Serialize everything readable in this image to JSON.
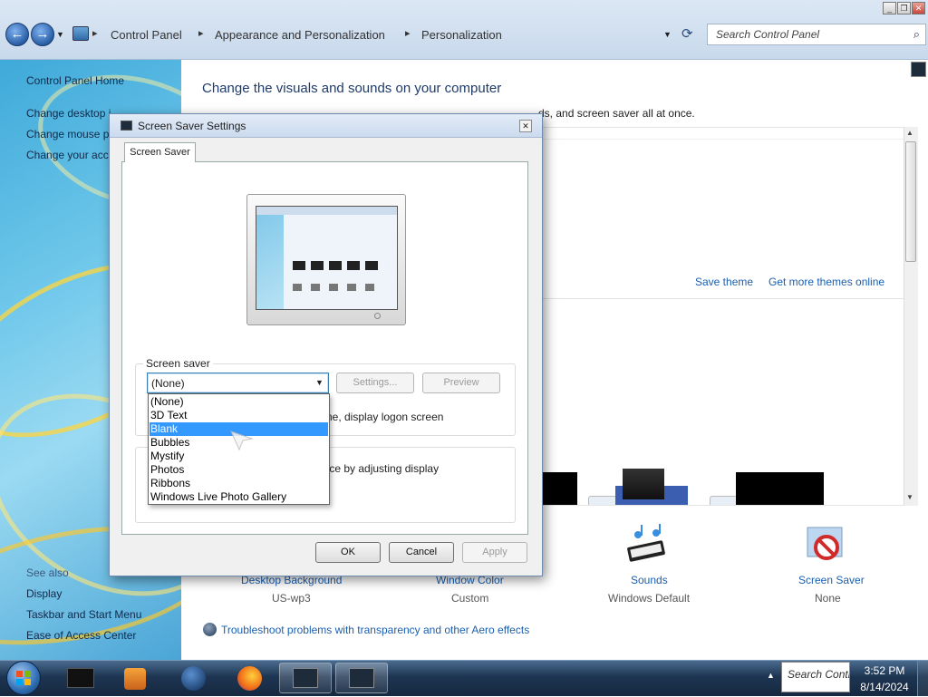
{
  "window": {
    "breadcrumb": [
      "Control Panel",
      "Appearance and Personalization",
      "Personalization"
    ],
    "search_placeholder": "Search Control Panel"
  },
  "left_pane": {
    "home": "Control Panel Home",
    "links": [
      "Change desktop i",
      "Change mouse p",
      "Change your acc"
    ],
    "see_also_heading": "See also",
    "see_also": [
      "Display",
      "Taskbar and Start Menu",
      "Ease of Access Center"
    ]
  },
  "main": {
    "heading": "Change the visuals and sounds on your computer",
    "description_tail": "ds, and screen saver all at once.",
    "save_theme": "Save theme",
    "get_more_themes": "Get more themes online",
    "settings": [
      {
        "label": "Desktop Background",
        "value": "US-wp3"
      },
      {
        "label": "Window Color",
        "value": "Custom"
      },
      {
        "label": "Sounds",
        "value": "Windows Default"
      },
      {
        "label": "Screen Saver",
        "value": "None"
      }
    ],
    "troubleshoot": "Troubleshoot problems with transparency and other Aero effects"
  },
  "dialog": {
    "title": "Screen Saver Settings",
    "tab": "Screen Saver",
    "group_label": "Screen saver",
    "dropdown_value": "(None)",
    "settings_btn": "Settings...",
    "preview_btn": "Preview",
    "resume_text_tail": "ume, display logon screen",
    "power_text_tail": "ance by adjusting display",
    "options": [
      "(None)",
      "3D Text",
      "Blank",
      "Bubbles",
      "Mystify",
      "Photos",
      "Ribbons",
      "Windows Live Photo Gallery"
    ],
    "highlighted_option": "Blank",
    "ok": "OK",
    "cancel": "Cancel",
    "apply": "Apply"
  },
  "taskbar": {
    "search_text": "Search Contr",
    "time": "3:52 PM",
    "date": "8/14/2024"
  }
}
